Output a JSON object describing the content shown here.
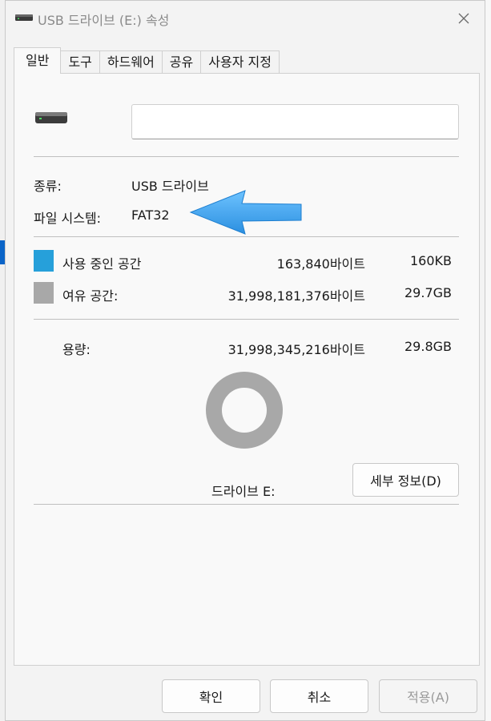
{
  "window": {
    "title": "USB 드라이브 (E:) 속성",
    "close_glyph": "✕"
  },
  "tabs": [
    {
      "label": "일반",
      "active": true
    },
    {
      "label": "도구",
      "active": false
    },
    {
      "label": "하드웨어",
      "active": false
    },
    {
      "label": "공유",
      "active": false
    },
    {
      "label": "사용자 지정",
      "active": false
    }
  ],
  "general": {
    "drive_name_value": "",
    "type_label": "종류:",
    "type_value": "USB 드라이브",
    "fs_label": "파일 시스템:",
    "fs_value": "FAT32",
    "used": {
      "label": "사용 중인 공간",
      "bytes": "163,840바이트",
      "size": "160KB",
      "color": "#26a0da"
    },
    "free": {
      "label": "여유 공간:",
      "bytes": "31,998,181,376바이트",
      "size": "29.7GB",
      "color": "#a8a8a8"
    },
    "capacity": {
      "label": "용량:",
      "bytes": "31,998,345,216바이트",
      "size": "29.8GB"
    },
    "usage_fraction": 5.1e-06,
    "drive_label": "드라이브 E:",
    "details_button": "세부 정보(D)"
  },
  "annotation": {
    "arrow_color": "#3aa0ec",
    "icon": "left-arrow-icon"
  },
  "buttons": {
    "ok": "확인",
    "cancel": "취소",
    "apply": "적용(A)"
  }
}
